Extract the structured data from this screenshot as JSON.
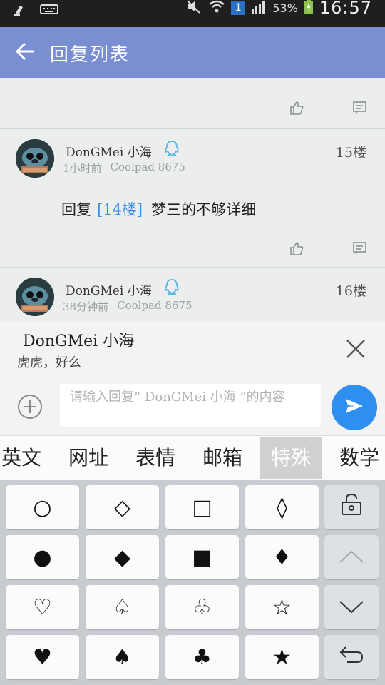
{
  "status_bar": {
    "sim": "1",
    "battery": "53%",
    "time": "16:57"
  },
  "app_bar": {
    "title": "回复列表"
  },
  "posts": [
    {
      "name": "DonGMei  小海",
      "time": "1小时前",
      "device": "Coolpad 8675",
      "floor": "15楼",
      "reply_prefix": "回复",
      "reply_link": "[14楼]",
      "reply_body": "梦三的不够详细"
    },
    {
      "name": "DonGMei  小海",
      "time": "38分钟前",
      "device": "Coolpad 8675",
      "floor": "16楼"
    }
  ],
  "reply_panel": {
    "target_name": "DonGMei  小海",
    "quote": "虎虎，好么",
    "input_placeholder": "请输入回复“ DonGMei  小海 ”的内容"
  },
  "keyboard": {
    "categories": [
      "英文",
      "网址",
      "表情",
      "邮箱",
      "特殊",
      "数学"
    ],
    "active_category": "特殊",
    "symbols": [
      [
        "○",
        "◇",
        "□",
        "◊"
      ],
      [
        "●",
        "◆",
        "■",
        "♦"
      ],
      [
        "♡",
        "♤",
        "♧",
        "☆"
      ],
      [
        "♥",
        "♠",
        "♣",
        "★"
      ]
    ]
  }
}
